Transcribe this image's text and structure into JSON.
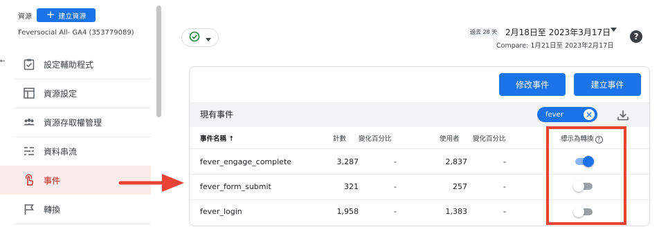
{
  "sidebar": {
    "resource_label": "資源",
    "create_resource_label": "建立資源",
    "account_name": "Feversocial All- GA4 (353779089)",
    "left_edge_arrow": "←",
    "items": [
      {
        "label": "設定輔助程式",
        "icon": "setup-assistant-icon"
      },
      {
        "label": "資源設定",
        "icon": "property-settings-icon"
      },
      {
        "label": "資源存取權管理",
        "icon": "access-management-icon"
      },
      {
        "label": "資料串流",
        "icon": "data-streams-icon"
      },
      {
        "label": "事件",
        "icon": "events-icon",
        "active": true
      },
      {
        "label": "轉換",
        "icon": "conversions-icon"
      }
    ]
  },
  "header": {
    "status_icon": "check-circle-icon",
    "date_chip": "過去 28 天",
    "date_range": "2月18日至 2023年3月17日",
    "compare_text": "Compare: 1月21日至 2023年2月17日",
    "help": "?"
  },
  "actions": {
    "modify_event": "修改事件",
    "create_event": "建立事件"
  },
  "table": {
    "title": "現有事件",
    "filter_chip": "fever",
    "columns": {
      "name": "事件名稱 ↑",
      "count": "計數",
      "change1": "變化百分比",
      "users": "使用者",
      "change2": "變化百分比",
      "mark_as_conversion": "標示為轉換"
    },
    "rows": [
      {
        "name": "fever_engage_complete",
        "count": "3,287",
        "change1": "-",
        "users": "2,837",
        "change2": "-",
        "conversion": true
      },
      {
        "name": "fever_form_submit",
        "count": "321",
        "change1": "-",
        "users": "257",
        "change2": "-",
        "conversion": false
      },
      {
        "name": "fever_login",
        "count": "1,958",
        "change1": "-",
        "users": "1,383",
        "change2": "-",
        "conversion": false
      }
    ]
  },
  "colors": {
    "accent": "#1a73e8",
    "active_nav_text": "#c5221f",
    "active_nav_bg": "#fbeceb",
    "annotation_red": "#ea4335"
  }
}
